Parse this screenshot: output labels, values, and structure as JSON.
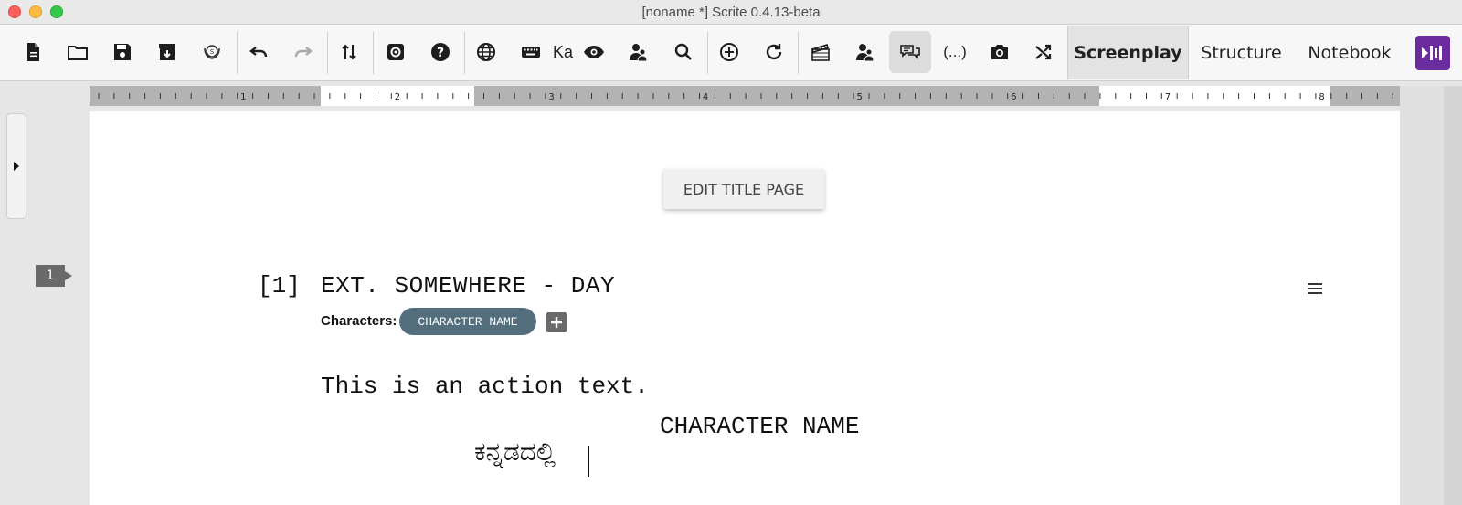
{
  "window": {
    "title": "[noname *] Scrite 0.4.13-beta"
  },
  "toolbar": {
    "buttons": [
      {
        "name": "new-file",
        "icon": "document-icon"
      },
      {
        "name": "open-file",
        "icon": "folder-icon"
      },
      {
        "name": "save",
        "icon": "floppy-disk-icon"
      },
      {
        "name": "export",
        "icon": "archive-download-icon"
      },
      {
        "name": "library",
        "icon": "laurel-badge-icon"
      },
      {
        "name": "undo",
        "icon": "undo-icon"
      },
      {
        "name": "redo",
        "icon": "redo-icon"
      },
      {
        "name": "import-export",
        "icon": "arrows-up-down-icon"
      },
      {
        "name": "settings",
        "icon": "gear-icon"
      },
      {
        "name": "help",
        "icon": "question-icon"
      },
      {
        "name": "language",
        "icon": "globe-icon"
      },
      {
        "name": "keyboard",
        "icon": "keyboard-icon"
      },
      {
        "name": "preview",
        "icon": "eye-icon"
      },
      {
        "name": "characters",
        "icon": "people-icon"
      },
      {
        "name": "find",
        "icon": "search-icon"
      },
      {
        "name": "add-scene",
        "icon": "plus-circle-icon"
      },
      {
        "name": "refresh",
        "icon": "refresh-icon"
      },
      {
        "name": "scene-clapper",
        "icon": "clapperboard-icon"
      },
      {
        "name": "character-people",
        "icon": "people-icon"
      },
      {
        "name": "dialogue",
        "icon": "speech-bubbles-icon"
      },
      {
        "name": "parenthetical",
        "icon": "parenthesis-icon"
      },
      {
        "name": "screenshot",
        "icon": "camera-icon"
      },
      {
        "name": "shuffle",
        "icon": "shuffle-icon"
      }
    ],
    "language_label": "Ka",
    "parenthetical_label": "(...)",
    "tabs": [
      {
        "label": "Screenplay",
        "active": true
      },
      {
        "label": "Structure",
        "active": false
      },
      {
        "label": "Notebook",
        "active": false
      }
    ]
  },
  "ruler": {
    "numbers": [
      "1",
      "2",
      "3",
      "4",
      "5",
      "6",
      "7",
      "8"
    ]
  },
  "page": {
    "edit_title_label": "EDIT TITLE PAGE",
    "scene_index_tag": "1",
    "scene": {
      "number": "[1]",
      "heading": "EXT. SOMEWHERE - DAY",
      "characters_label": "Characters:",
      "characters": [
        "CHARACTER NAME"
      ],
      "action": "This is an action text.",
      "character": "CHARACTER NAME",
      "dialogue": "ಕನ್ನಡದಲ್ಲಿ"
    }
  },
  "colors": {
    "accent": "#536f7e",
    "app_logo": "#6b2d9e"
  }
}
